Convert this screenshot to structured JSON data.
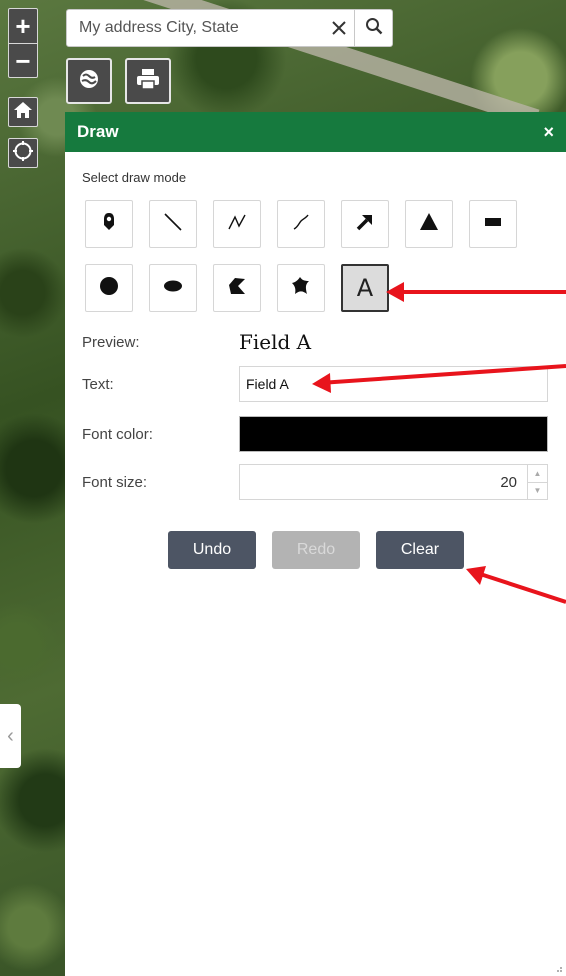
{
  "map": {
    "zoom_in": "+",
    "zoom_out": "−",
    "search": {
      "placeholder": "My address City, State",
      "value": ""
    },
    "icons": {
      "home": "home-icon",
      "locate": "locate-icon",
      "basemap": "basemap-gallery-icon",
      "print": "print-icon",
      "search": "search-icon",
      "clear": "close-icon",
      "collapse": "chevron-left-icon"
    },
    "collapse_glyph": "‹"
  },
  "panel": {
    "title": "Draw",
    "close_glyph": "×",
    "header_color": "#167a3e",
    "mode_label": "Select draw mode",
    "modes": [
      {
        "name": "point",
        "icon": "map-pin-icon"
      },
      {
        "name": "line",
        "icon": "line-icon"
      },
      {
        "name": "polyline",
        "icon": "polyline-icon"
      },
      {
        "name": "freehand-polyline",
        "icon": "freehand-line-icon"
      },
      {
        "name": "arrow",
        "icon": "arrow-icon"
      },
      {
        "name": "triangle",
        "icon": "triangle-icon"
      },
      {
        "name": "rectangle",
        "icon": "rectangle-icon"
      },
      {
        "name": "circle",
        "icon": "circle-icon"
      },
      {
        "name": "ellipse",
        "icon": "ellipse-icon"
      },
      {
        "name": "polygon",
        "icon": "polygon-icon"
      },
      {
        "name": "freehand-polygon",
        "icon": "freehand-polygon-icon"
      },
      {
        "name": "text",
        "icon": "text-icon",
        "glyph": "A",
        "selected": true
      }
    ],
    "preview_label": "Preview:",
    "preview_value": "Field A",
    "text_label": "Text:",
    "text_value": "Field A",
    "font_color_label": "Font color:",
    "font_color_value": "#000000",
    "font_size_label": "Font size:",
    "font_size_value": "20",
    "undo_label": "Undo",
    "redo_label": "Redo",
    "clear_label": "Clear"
  },
  "annotation_color": "#e8141c"
}
